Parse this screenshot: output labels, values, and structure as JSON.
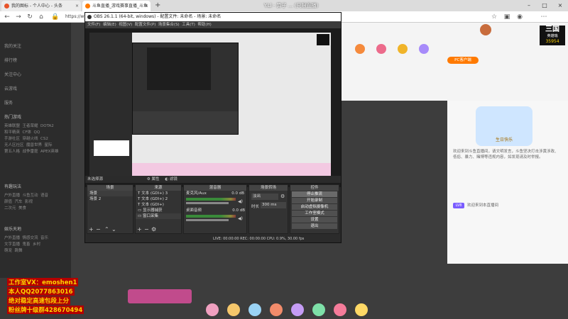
{
  "browser": {
    "tabs": [
      {
        "label": "我的图标 - 个人中心 - 头条"
      },
      {
        "label": "斗鱼直播_游戏赛事直播_斗鱼"
      }
    ],
    "url": "https://www.do"
  },
  "sidebar": {
    "items": [
      "我的关注",
      "排行榜",
      "关注中心",
      "云游戏",
      "服务"
    ],
    "section_hot": "热门游戏",
    "hot_games": [
      "英雄联盟",
      "王者荣耀",
      "DOTA2",
      "和平精英",
      "CF体",
      "QQ",
      "手游社区",
      "穿越火线",
      "CS2",
      "无人区社区",
      "魔兽世界",
      "星际",
      "第五人格",
      "战争雷霆",
      "APEX英雄"
    ],
    "section_more": "有趣玩法",
    "more": [
      "户外直播",
      "斗鱼互动",
      "语音",
      "颜值",
      "汽车",
      "影视",
      "二次元",
      "美食"
    ],
    "section_ent": "娱乐天地",
    "ent": [
      "户外直播",
      "情感交流",
      "音乐",
      "文字直播",
      "鬼畜",
      "乡村",
      "萌宠",
      "跳舞"
    ]
  },
  "watermark": {
    "line1": "工作室VX：emoshen1",
    "line2": "本人QQ2077863016",
    "line3": "绝对稳定高速包段上分",
    "line4": "粉丝牌十级群428670494"
  },
  "overlay_title": "Y.Ll - 算子 ... (只限直播)",
  "obs": {
    "title": "OBS 26.1.1 (64-bit, windows) - 配置文件: 未命名 - 场景: 未命名",
    "menu": [
      "文件(F)",
      "编辑(E)",
      "视图(V)",
      "配置文件(P)",
      "场景集合(S)",
      "工具(T)",
      "帮助(H)"
    ],
    "preview_label": "未选择源",
    "props_label": "属性",
    "filter_label": "滤镜",
    "scenes_header": "场景",
    "scenes": [
      "场景",
      "场景 2"
    ],
    "sources_header": "来源",
    "sources": [
      "文本 (GDI+) 3",
      "文本 (GDI+) 2",
      "文本 (GDI+)",
      "显示器捕获",
      "窗口采集"
    ],
    "mixer_header": "混音器",
    "mixer": [
      {
        "name": "麦克风/Aux",
        "db": "0.0 dB"
      },
      {
        "name": "桌面音频",
        "db": "0.0 dB"
      }
    ],
    "transition_header": "场景转场",
    "transition_value": "淡出",
    "duration_label": "时长",
    "duration_value": "300 ms",
    "controls_header": "控件",
    "controls": [
      "停止推流",
      "开始录制",
      "启动虚拟摄像机",
      "工作室模式",
      "设置",
      "退出"
    ],
    "status": "LIVE: 00:00:00   REC: 00:00:00   CPU: 0.9%, 30.00 fps"
  },
  "right_panel": {
    "banner": "生日快乐",
    "text": "欢迎来到斗鱼直播间，请文明发言，斗鱼坚决打击涉黄涉政、低俗、暴力、赌博等违规内容，如发现请及时举报。",
    "badge": "LV8",
    "chat": "欢迎来到本直播间",
    "pc_badge": "PC客户端"
  },
  "corner_logo": {
    "name": "三国",
    "sub": "英雄瑞",
    "count": "35954"
  }
}
